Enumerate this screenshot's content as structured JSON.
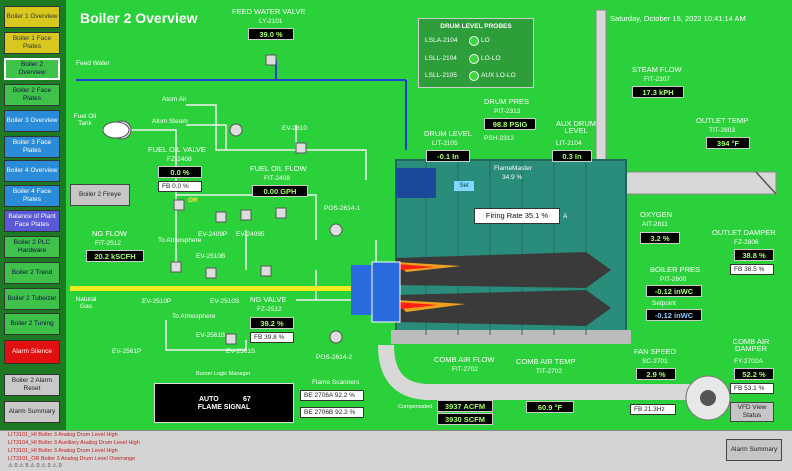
{
  "nav": [
    {
      "label": "Boiler 1 Overview",
      "color": "yellow"
    },
    {
      "label": "Boiler 1 Face Plates",
      "color": "yellow"
    },
    {
      "label": "Boiler 2 Overview",
      "color": "green"
    },
    {
      "label": "Boiler 2 Face Plates",
      "color": "green"
    },
    {
      "label": "Boiler 3 Overview",
      "color": "blue"
    },
    {
      "label": "Boiler 3 Face Plates",
      "color": "blue"
    },
    {
      "label": "Boiler 4 Overview",
      "color": "blue"
    },
    {
      "label": "Boiler 4 Face Plates",
      "color": "blue"
    },
    {
      "label": "Balance of Plant Face Plates",
      "color": "purple"
    },
    {
      "label": "Boiler 2 PLC Hardware",
      "color": "green"
    },
    {
      "label": "Boiler 2 Trend",
      "color": "green"
    },
    {
      "label": "Boiler 2 Tubeizer",
      "color": "green"
    },
    {
      "label": "Boiler 2 Tuning",
      "color": "green"
    },
    {
      "label": "Alarm Silence",
      "color": "red"
    },
    {
      "label": "Boiler 2 Alarm Reset",
      "color": "gray"
    },
    {
      "label": "Alarm Summary",
      "color": "gray"
    }
  ],
  "header": {
    "title": "Boiler 2 Overview",
    "datetime": "Saturday, October 15, 2022 10:41:14 AM"
  },
  "feedwater": {
    "label": "FEED WATER VALVE",
    "tag": "LY-2101",
    "value": "39.0 %",
    "line": "Feed Water"
  },
  "probes": {
    "title": "DRUM LEVEL PROBES",
    "rows": [
      {
        "tag": "LSLA-2104",
        "state": "LO"
      },
      {
        "tag": "LSLL-2104",
        "state": "LO-LO"
      },
      {
        "tag": "LSLL-2105",
        "state": "AUX LO-LO"
      }
    ]
  },
  "steam_flow": {
    "label": "STEAM FLOW",
    "tag": "FIT-2307",
    "value": "17.3 kPH"
  },
  "outlet_temp": {
    "label": "OUTLET TEMP",
    "tag": "TIT-2803",
    "value": "394 °F"
  },
  "drum_pres": {
    "label": "DRUM PRES",
    "tag": "PIT-2313",
    "value": "98.8 PSIG"
  },
  "drum_level": {
    "label": "DRUM LEVEL",
    "tag": "LIT-2105",
    "value": "-0.1 In"
  },
  "aux_drum_level": {
    "label": "AUX DRUM LEVEL",
    "tag": "LIT-2104",
    "value": "0.3 In"
  },
  "psh": {
    "tag": "PSH-2312"
  },
  "fuel_oil": {
    "tank": "Fuel Oil Tank",
    "atom_air": "Atom Air",
    "atom_steam": "Atom Steam",
    "valve_label": "FUEL OIL VALVE",
    "valve_tag": "FZ-2408",
    "valve_value": "0.0 %",
    "valve_fb": "FB 0.0 %",
    "flow_label": "FUEL OIL FLOW",
    "flow_tag": "FIT-2408",
    "flow_value": "0.00 GPH",
    "ev2610": "EV-2610",
    "ev2409p": "EV-2409P",
    "ev2409s": "EV-24095",
    "or": "OR"
  },
  "firing": {
    "fireye": "Boiler 2 Fireye",
    "flameMaster": "FlameMaster",
    "fm_value": "34.9 %",
    "rate_label": "Firing Rate",
    "rate_value": "35.1 %",
    "set": "Set",
    "letter_a": "A"
  },
  "ng": {
    "flow_label": "NG FLOW",
    "flow_tag": "FIT-2512",
    "flow_value": "20.2 kSCFH",
    "to_atmos1": "To Atmosphere",
    "to_atmos2": "To Atmosphere",
    "natural_gas": "Natural Gas",
    "ev2510b": "EV-2510B",
    "ev2510p": "EV-2510P",
    "ev2510s": "EV-2510S",
    "valve_label": "NG VALVE",
    "valve_tag": "FZ-2512",
    "valve_value": "39.2 %",
    "valve_fb": "FB 39.8 %",
    "ev2561b": "EV-2561B",
    "ev2561p": "EV-2561P",
    "ev2561s": "EV-2561S",
    "pos1": "POS-2614-1",
    "pos2": "POS-2614-2",
    "burner_logic": "Burner Logic Manager"
  },
  "oxygen": {
    "label": "OXYGEN",
    "tag": "AIT-2811",
    "value": "3.2 %"
  },
  "outlet_damper": {
    "label": "OUTLET DAMPER",
    "tag": "FZ-2806",
    "value": "38.8 %",
    "fb": "FB 38.5 %"
  },
  "boiler_pres": {
    "label": "BOILER PRES",
    "tag": "PIT-2600",
    "value": "-0.12 inWC",
    "setpoint_label": "Setpoint",
    "setpoint": "-0.12 inWC"
  },
  "fan_speed": {
    "label": "FAN SPEED",
    "tag": "SC-2701",
    "value": "2.9 %",
    "fb": "FB 21.3Hz"
  },
  "comb_damper": {
    "label": "COMB AIR DAMPER",
    "tag": "FY-2702A",
    "value": "52.2 %",
    "fb": "FB 53.1 %"
  },
  "vfd": {
    "label": "VFD View Status"
  },
  "comb_flow": {
    "label": "COMB AIR FLOW",
    "tag": "FIT-2702",
    "acfm": "3937 ACFM",
    "scfm": "3930 SCFM",
    "comp": "Compensated"
  },
  "comb_temp": {
    "label": "COMB AIR TEMP",
    "tag": "TIT-2702",
    "value": "60.9 °F"
  },
  "flame": {
    "mode": "AUTO",
    "signal_value": "67",
    "signal_label": "FLAME SIGNAL"
  },
  "scanners": {
    "title": "Flame Scanners",
    "s1": "BE 2706A  92.2 %",
    "s2": "BE 2706B  92.2 %"
  },
  "alarms": {
    "lines": [
      "LIT3101_HI Boiler 3 Analog Drum Level High",
      "LIT3104_HI Boiler 3 Auxiliary Analog Drum Level High",
      "LIT3101_HI Boiler 3 Analog Drum Level High",
      "LIT3101_OR Boiler 3 Analog Drum Level Overrange"
    ],
    "counts": "⚠ 0   ⚠ 5   ⚠ 0   ⚠ 0   ⚠ 0",
    "summary": "Alarm Summary"
  }
}
